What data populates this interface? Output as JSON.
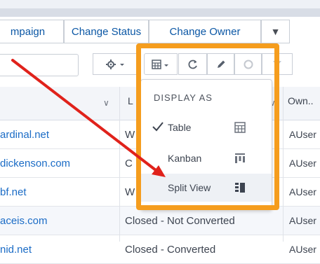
{
  "actions": {
    "campaign": "mpaign",
    "change_status": "Change Status",
    "change_owner": "Change Owner"
  },
  "display_menu": {
    "heading": "DISPLAY AS",
    "items": [
      {
        "label": "Table",
        "icon": "table-icon",
        "checked": true
      },
      {
        "label": "Kanban",
        "icon": "kanban-icon",
        "checked": false
      },
      {
        "label": "Split View",
        "icon": "split-view-icon",
        "checked": false
      }
    ]
  },
  "table": {
    "header_status_fragment": "L",
    "header_owner": "Own..",
    "rows": [
      {
        "site": "ardinal.net",
        "status": "W",
        "owner": "AUser"
      },
      {
        "site": "dickenson.com",
        "status": "C",
        "owner": "AUser"
      },
      {
        "site": "bf.net",
        "status": "W",
        "owner": "AUser"
      },
      {
        "site": "aceis.com",
        "status": "Closed - Not Converted",
        "owner": "AUser"
      },
      {
        "site": "nid.net",
        "status": "Closed - Converted",
        "owner": "AUser"
      }
    ]
  },
  "colors": {
    "highlight": "#f59d1e",
    "arrow": "#e0221b",
    "link": "#1b6cc6"
  }
}
